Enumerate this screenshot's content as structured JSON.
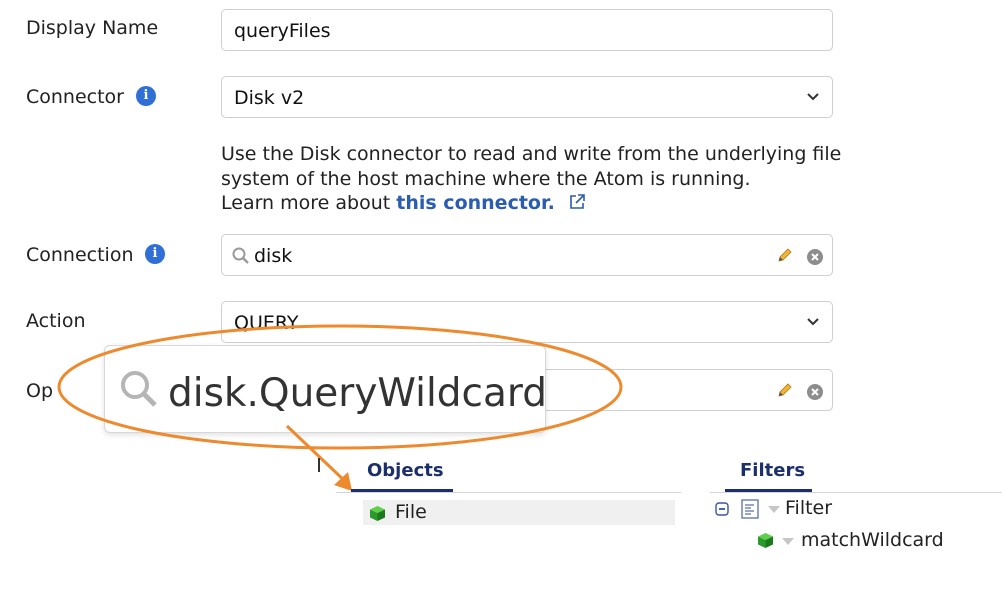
{
  "form": {
    "display_name_label": "Display Name",
    "display_name_value": "queryFiles",
    "connector_label": "Connector",
    "connector_value": "Disk v2",
    "description_line1": "Use the Disk connector to read and write from the underlying file",
    "description_line2": "system of the host machine where the Atom is running.",
    "learn_more_prefix": "Learn more about ",
    "learn_more_link": "this connector.",
    "connection_label": "Connection",
    "connection_value": "disk",
    "action_label": "Action",
    "action_value": "QUERY",
    "operation_label_partial": "Op"
  },
  "zoom_callout": {
    "text": "disk.QueryWildcard",
    "color": "#ee8a2e"
  },
  "objects_panel": {
    "tab_label": "Objects",
    "items": [
      {
        "label": "File"
      }
    ]
  },
  "filters_panel": {
    "tab_label": "Filters",
    "tree": [
      {
        "label": "Filter",
        "children": [
          {
            "label": "matchWildcard"
          }
        ]
      }
    ]
  },
  "colors": {
    "accent_blue": "#2f6fd6",
    "link": "#2a5db0",
    "tab_navy": "#1c2f6b",
    "highlight": "#ee8a2e"
  },
  "icons": [
    "info-icon",
    "chevron-down-icon",
    "search-icon",
    "pencil-icon",
    "clear-icon",
    "external-link-icon",
    "cube-icon",
    "collapse-icon",
    "document-icon"
  ]
}
